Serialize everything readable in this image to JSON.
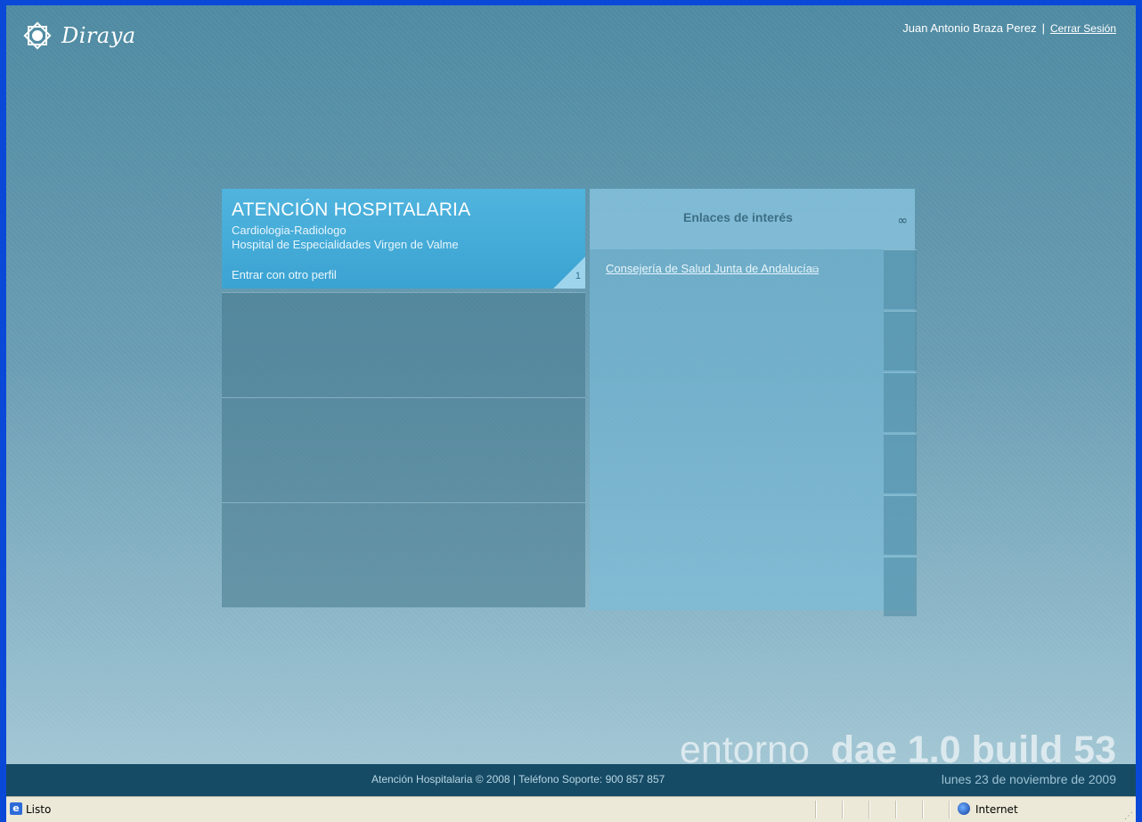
{
  "app": {
    "logo_text": "Diraya",
    "user_name": "Juan Antonio Braza Perez",
    "separator": "|",
    "logout_label": "Cerrar Sesión"
  },
  "profile": {
    "title": "ATENCIÓN HOSPITALARIA",
    "specialty": "Cardiologia-Radiologo",
    "hospital": "Hospital de Especialidades Virgen de Valme",
    "switch_profile_label": "Entrar con otro perfil",
    "count": "1"
  },
  "links": {
    "title": "Enlaces de interés",
    "items": [
      {
        "label": "Consejería de Salud Junta de Andalucía",
        "icon": "external-link-icon"
      }
    ],
    "header_icon": "link-icon"
  },
  "build": {
    "prefix": "entorno",
    "version": "dae 1.0 build 53"
  },
  "footer": {
    "copyright": "Atención Hospitalaria © 2008 | Teléfono Soporte: 900 857 857",
    "date": "lunes 23 de noviembre de 2009"
  },
  "statusbar": {
    "status": "Listo",
    "zone": "Internet"
  },
  "colors": {
    "frame": "#0a49d8",
    "profile_card": "#3ba3d2",
    "footer": "#164b66"
  }
}
